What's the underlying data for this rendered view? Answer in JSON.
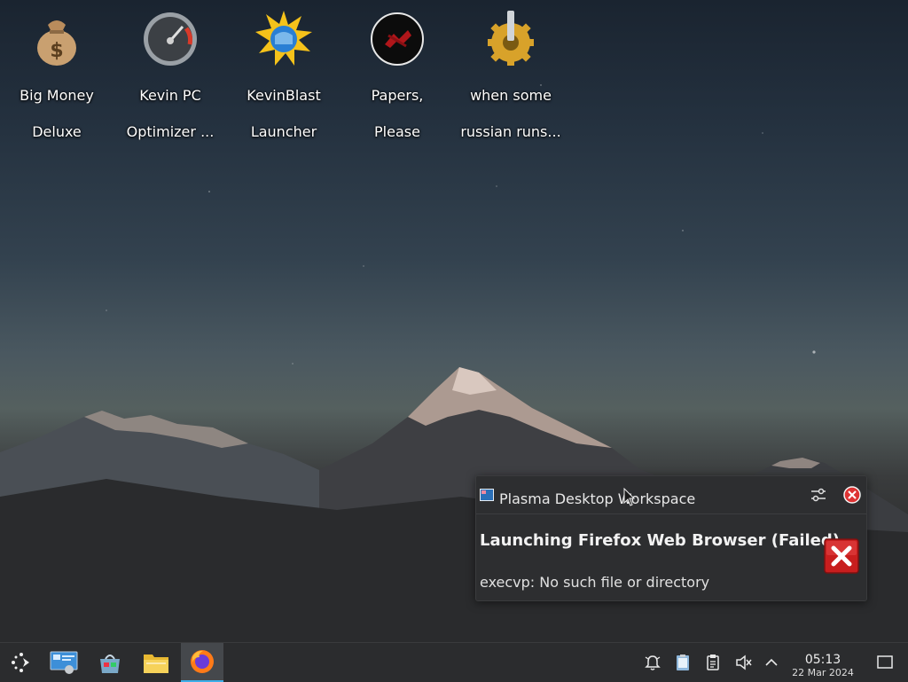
{
  "desktop": {
    "icons": [
      {
        "line1": "Big Money",
        "line2": "Deluxe",
        "icon": "money-bag-icon"
      },
      {
        "line1": "Kevin PC",
        "line2": "Optimizer ...",
        "icon": "speedometer-icon"
      },
      {
        "line1": "KevinBlast",
        "line2": "Launcher",
        "icon": "sun-globe-icon"
      },
      {
        "line1": "Papers,",
        "line2": "Please",
        "icon": "papers-please-icon"
      },
      {
        "line1": "when some",
        "line2": "russian runs...",
        "icon": "gear-icon"
      }
    ]
  },
  "notification": {
    "app_name": "Plasma Desktop Workspace",
    "title": "Launching Firefox Web Browser (Failed)",
    "body": "execvp: No such file or directory",
    "config_icon": "settings-sliders-icon",
    "close_icon": "close-icon",
    "status_icon": "error-icon"
  },
  "taskbar": {
    "launcher_icon": "app-launcher-icon",
    "pinned": [
      {
        "name": "system-settings-icon"
      },
      {
        "name": "discover-store-icon"
      },
      {
        "name": "file-manager-icon"
      },
      {
        "name": "firefox-icon",
        "active": true
      }
    ],
    "tray": [
      {
        "name": "notifications-icon"
      },
      {
        "name": "clipboard-paste-icon"
      },
      {
        "name": "clipboard-icon"
      },
      {
        "name": "volume-muted-icon"
      },
      {
        "name": "expand-tray-icon"
      }
    ],
    "clock": {
      "time": "05:13",
      "date": "22 Mar 2024"
    },
    "show_desktop_icon": "show-desktop-icon"
  },
  "colors": {
    "accent": "#3daee9",
    "error": "#d42020"
  }
}
